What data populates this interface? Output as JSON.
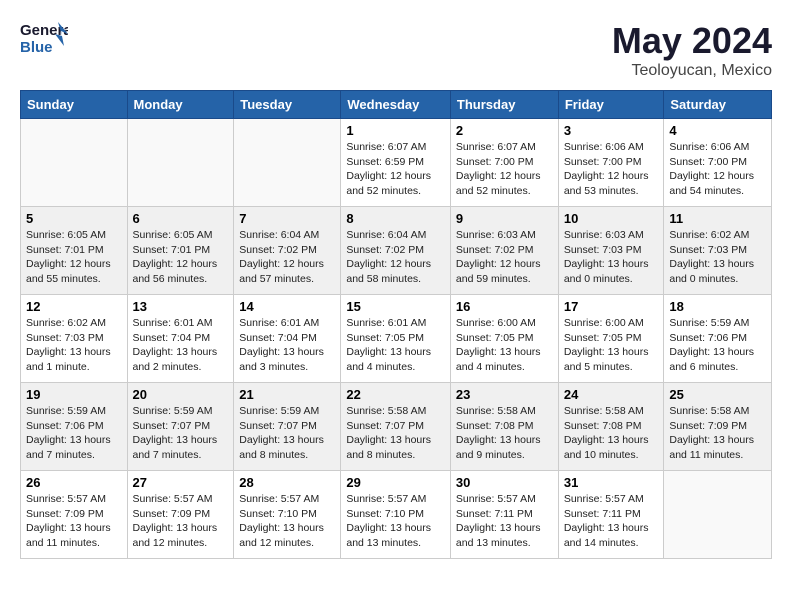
{
  "header": {
    "logo_line1": "General",
    "logo_line2": "Blue",
    "month": "May 2024",
    "location": "Teoloyucan, Mexico"
  },
  "days_of_week": [
    "Sunday",
    "Monday",
    "Tuesday",
    "Wednesday",
    "Thursday",
    "Friday",
    "Saturday"
  ],
  "weeks": [
    [
      {
        "day": "",
        "info": ""
      },
      {
        "day": "",
        "info": ""
      },
      {
        "day": "",
        "info": ""
      },
      {
        "day": "1",
        "info": "Sunrise: 6:07 AM\nSunset: 6:59 PM\nDaylight: 12 hours\nand 52 minutes."
      },
      {
        "day": "2",
        "info": "Sunrise: 6:07 AM\nSunset: 7:00 PM\nDaylight: 12 hours\nand 52 minutes."
      },
      {
        "day": "3",
        "info": "Sunrise: 6:06 AM\nSunset: 7:00 PM\nDaylight: 12 hours\nand 53 minutes."
      },
      {
        "day": "4",
        "info": "Sunrise: 6:06 AM\nSunset: 7:00 PM\nDaylight: 12 hours\nand 54 minutes."
      }
    ],
    [
      {
        "day": "5",
        "info": "Sunrise: 6:05 AM\nSunset: 7:01 PM\nDaylight: 12 hours\nand 55 minutes."
      },
      {
        "day": "6",
        "info": "Sunrise: 6:05 AM\nSunset: 7:01 PM\nDaylight: 12 hours\nand 56 minutes."
      },
      {
        "day": "7",
        "info": "Sunrise: 6:04 AM\nSunset: 7:02 PM\nDaylight: 12 hours\nand 57 minutes."
      },
      {
        "day": "8",
        "info": "Sunrise: 6:04 AM\nSunset: 7:02 PM\nDaylight: 12 hours\nand 58 minutes."
      },
      {
        "day": "9",
        "info": "Sunrise: 6:03 AM\nSunset: 7:02 PM\nDaylight: 12 hours\nand 59 minutes."
      },
      {
        "day": "10",
        "info": "Sunrise: 6:03 AM\nSunset: 7:03 PM\nDaylight: 13 hours\nand 0 minutes."
      },
      {
        "day": "11",
        "info": "Sunrise: 6:02 AM\nSunset: 7:03 PM\nDaylight: 13 hours\nand 0 minutes."
      }
    ],
    [
      {
        "day": "12",
        "info": "Sunrise: 6:02 AM\nSunset: 7:03 PM\nDaylight: 13 hours\nand 1 minute."
      },
      {
        "day": "13",
        "info": "Sunrise: 6:01 AM\nSunset: 7:04 PM\nDaylight: 13 hours\nand 2 minutes."
      },
      {
        "day": "14",
        "info": "Sunrise: 6:01 AM\nSunset: 7:04 PM\nDaylight: 13 hours\nand 3 minutes."
      },
      {
        "day": "15",
        "info": "Sunrise: 6:01 AM\nSunset: 7:05 PM\nDaylight: 13 hours\nand 4 minutes."
      },
      {
        "day": "16",
        "info": "Sunrise: 6:00 AM\nSunset: 7:05 PM\nDaylight: 13 hours\nand 4 minutes."
      },
      {
        "day": "17",
        "info": "Sunrise: 6:00 AM\nSunset: 7:05 PM\nDaylight: 13 hours\nand 5 minutes."
      },
      {
        "day": "18",
        "info": "Sunrise: 5:59 AM\nSunset: 7:06 PM\nDaylight: 13 hours\nand 6 minutes."
      }
    ],
    [
      {
        "day": "19",
        "info": "Sunrise: 5:59 AM\nSunset: 7:06 PM\nDaylight: 13 hours\nand 7 minutes."
      },
      {
        "day": "20",
        "info": "Sunrise: 5:59 AM\nSunset: 7:07 PM\nDaylight: 13 hours\nand 7 minutes."
      },
      {
        "day": "21",
        "info": "Sunrise: 5:59 AM\nSunset: 7:07 PM\nDaylight: 13 hours\nand 8 minutes."
      },
      {
        "day": "22",
        "info": "Sunrise: 5:58 AM\nSunset: 7:07 PM\nDaylight: 13 hours\nand 8 minutes."
      },
      {
        "day": "23",
        "info": "Sunrise: 5:58 AM\nSunset: 7:08 PM\nDaylight: 13 hours\nand 9 minutes."
      },
      {
        "day": "24",
        "info": "Sunrise: 5:58 AM\nSunset: 7:08 PM\nDaylight: 13 hours\nand 10 minutes."
      },
      {
        "day": "25",
        "info": "Sunrise: 5:58 AM\nSunset: 7:09 PM\nDaylight: 13 hours\nand 11 minutes."
      }
    ],
    [
      {
        "day": "26",
        "info": "Sunrise: 5:57 AM\nSunset: 7:09 PM\nDaylight: 13 hours\nand 11 minutes."
      },
      {
        "day": "27",
        "info": "Sunrise: 5:57 AM\nSunset: 7:09 PM\nDaylight: 13 hours\nand 12 minutes."
      },
      {
        "day": "28",
        "info": "Sunrise: 5:57 AM\nSunset: 7:10 PM\nDaylight: 13 hours\nand 12 minutes."
      },
      {
        "day": "29",
        "info": "Sunrise: 5:57 AM\nSunset: 7:10 PM\nDaylight: 13 hours\nand 13 minutes."
      },
      {
        "day": "30",
        "info": "Sunrise: 5:57 AM\nSunset: 7:11 PM\nDaylight: 13 hours\nand 13 minutes."
      },
      {
        "day": "31",
        "info": "Sunrise: 5:57 AM\nSunset: 7:11 PM\nDaylight: 13 hours\nand 14 minutes."
      },
      {
        "day": "",
        "info": ""
      }
    ]
  ]
}
